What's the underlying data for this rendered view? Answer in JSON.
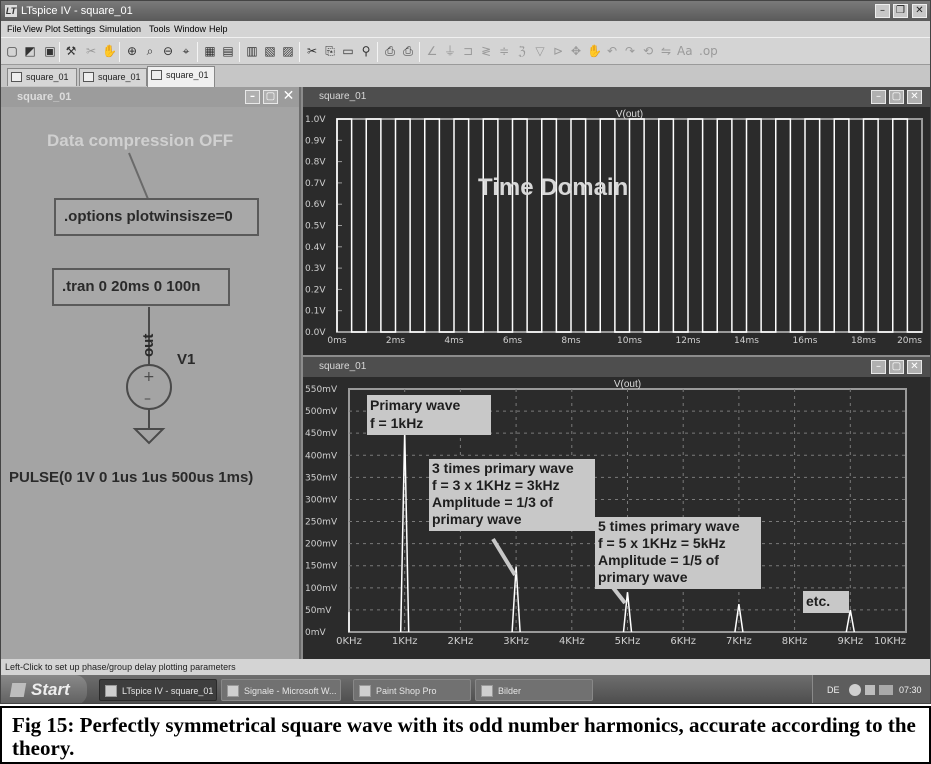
{
  "window": {
    "title": "LTspice IV - square_01",
    "logo_text": "LT"
  },
  "menu": [
    "File",
    "View",
    "Plot Settings",
    "Simulation",
    "Tools",
    "Window",
    "Help"
  ],
  "tabs": [
    {
      "label": "square_01",
      "icon": "schematic-icon"
    },
    {
      "label": "square_01",
      "icon": "waveform-icon"
    },
    {
      "label": "square_01",
      "icon": "waveform-icon"
    }
  ],
  "schematic": {
    "title": "square_01",
    "comment": "Data compression OFF",
    "directive1": ".options plotwinsisze=0",
    "directive2": ".tran 0 20ms 0 100n",
    "net_label": "out",
    "source_name": "V1",
    "source_value": "PULSE(0 1V 0 1us 1us 500us 1ms)"
  },
  "plot_top": {
    "title": "square_01",
    "trace_label": "V(out)",
    "annotation": "Time Domain"
  },
  "plot_bottom": {
    "title": "square_01",
    "trace_label": "V(out)",
    "annotations": [
      {
        "lines": [
          "Primary wave",
          "f = 1kHz"
        ]
      },
      {
        "lines": [
          "3 times primary wave",
          "f = 3 x 1KHz = 3kHz",
          "Amplitude = 1/3 of",
          "primary wave"
        ]
      },
      {
        "lines": [
          "5 times primary wave",
          "f = 5 x 1KHz = 5kHz",
          "Amplitude = 1/5 of",
          "primary wave"
        ]
      },
      {
        "lines": [
          "etc."
        ]
      }
    ]
  },
  "chart_data": [
    {
      "type": "line",
      "title": "V(out)",
      "x_unit": "ms",
      "xlim": [
        0,
        20
      ],
      "ylim": [
        0,
        1.0
      ],
      "x_ticks": [
        "0ms",
        "2ms",
        "4ms",
        "6ms",
        "8ms",
        "10ms",
        "12ms",
        "14ms",
        "16ms",
        "18ms",
        "20ms"
      ],
      "y_ticks": [
        "0.0V",
        "0.1V",
        "0.2V",
        "0.3V",
        "0.4V",
        "0.5V",
        "0.6V",
        "0.7V",
        "0.8V",
        "0.9V",
        "1.0V"
      ],
      "series": [
        {
          "name": "V(out)",
          "waveform": "square",
          "period_ms": 1,
          "high_ms": 0.5,
          "low": 0,
          "high": 1.0
        }
      ],
      "grid": false
    },
    {
      "type": "line",
      "title": "V(out)",
      "x_unit": "KHz",
      "xlim": [
        0,
        10
      ],
      "ylim": [
        0,
        550
      ],
      "x_ticks": [
        "0KHz",
        "1KHz",
        "2KHz",
        "3KHz",
        "4KHz",
        "5KHz",
        "6KHz",
        "7KHz",
        "8KHz",
        "9KHz",
        "10KHz"
      ],
      "y_ticks": [
        "0mV",
        "50mV",
        "100mV",
        "150mV",
        "200mV",
        "250mV",
        "300mV",
        "350mV",
        "400mV",
        "450mV",
        "500mV",
        "550mV"
      ],
      "series": [
        {
          "name": "V(out)",
          "x": [
            1,
            3,
            5,
            7,
            9
          ],
          "values": [
            455,
            148,
            90,
            63,
            50
          ]
        }
      ],
      "grid": true
    }
  ],
  "status": "Left-Click to set up phase/group delay plotting parameters",
  "taskbar": {
    "start": "Start",
    "tasks": [
      "LTspice IV - square_01",
      "Signale - Microsoft W...",
      "Paint Shop Pro",
      "Bilder"
    ],
    "language": "DE",
    "clock": "07:30"
  },
  "caption": "Fig 15: Perfectly symmetrical square wave with its odd number harmonics, accurate according to the theory.",
  "colors": {
    "plot_bg": "#2b2b2b",
    "plot_border": "#9a9a9a",
    "trace": "#ffffff",
    "schematic_bg": "#a4a4a4",
    "annotation_box": "#c8c8c8"
  }
}
